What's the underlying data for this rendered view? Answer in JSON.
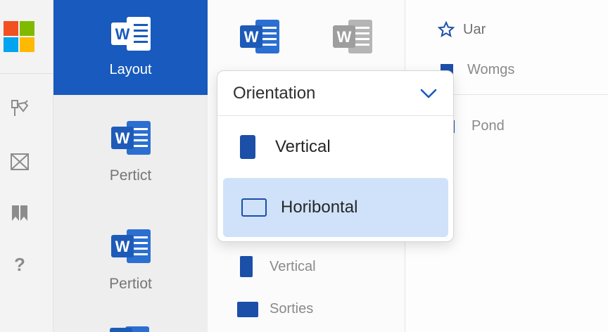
{
  "colors": {
    "accent": "#185abd",
    "word_blue": "#1e5bb8",
    "selected_option_bg": "#cfe2f9",
    "ms_logo": [
      "#f25022",
      "#7fba00",
      "#00a4ef",
      "#ffb900"
    ]
  },
  "rail": {
    "icons": [
      "microsoft-logo",
      "pin-icon",
      "mail-icon",
      "bookmark-icon",
      "help-icon"
    ],
    "help_glyph": "?"
  },
  "templates": {
    "tiles": [
      {
        "label": "Layout",
        "selected": true
      },
      {
        "label": "Pertict",
        "selected": false
      },
      {
        "label": "Pertiot",
        "selected": false
      }
    ]
  },
  "dropdown": {
    "title": "Orientation",
    "options": [
      {
        "label": "Vertical",
        "selected": false
      },
      {
        "label": "Horibontal",
        "selected": true
      }
    ]
  },
  "middle_list": [
    {
      "label": "Vertical"
    },
    {
      "label": "Sorties"
    }
  ],
  "right_panel": {
    "items": [
      {
        "label": "Uar",
        "icon": "star-icon"
      },
      {
        "label": "Womgs",
        "icon": "square-icon"
      },
      {
        "label": "Pond",
        "icon": "square-icon"
      }
    ]
  }
}
